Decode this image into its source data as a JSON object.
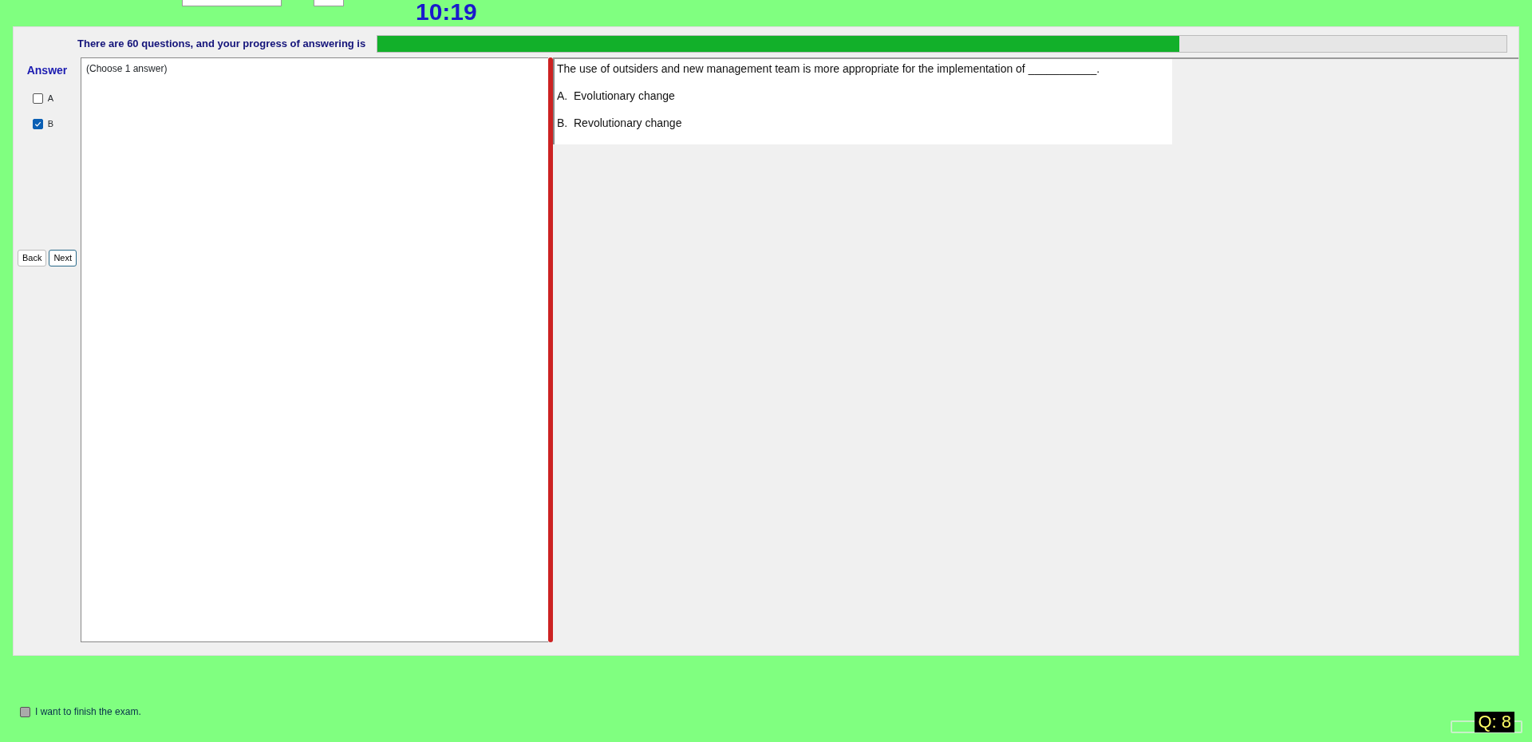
{
  "timer": "10:19",
  "progress": {
    "label": "There are 60 questions, and your progress of answering is",
    "level": 0.71
  },
  "answer": {
    "title": "Answer",
    "options": [
      {
        "label": "A",
        "checked": false
      },
      {
        "label": "B",
        "checked": true
      }
    ],
    "back": "Back",
    "next": "Next"
  },
  "answer_area": {
    "hint": "(Choose 1 answer)"
  },
  "question": {
    "text": "The use of outsiders and new management team is more appropriate for the implementation of ___________.",
    "choices": [
      "A.  Evolutionary change",
      "B.  Revolutionary change"
    ]
  },
  "finish": {
    "label": "I want to finish the exam.",
    "checked": false
  },
  "question_number": "Q: 8"
}
